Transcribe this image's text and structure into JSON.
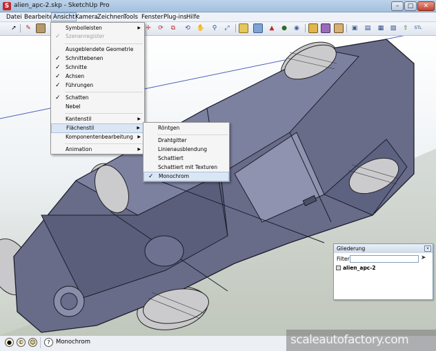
{
  "window": {
    "title": "alien_apc-2.skp - SketchUp Pro"
  },
  "menubar": {
    "items": [
      "Datei",
      "Bearbeiten",
      "Ansicht",
      "Kamera",
      "Zeichnen",
      "Tools",
      "Fenster",
      "Plug-ins",
      "Hilfe"
    ]
  },
  "view_menu": {
    "items": [
      {
        "label": "Symbolleisten",
        "submenu": true
      },
      {
        "label": "Szenenregister",
        "disabled": true,
        "checked": true
      },
      {
        "label": "Ausgeblendete Geometrie"
      },
      {
        "label": "Schnittebenen",
        "checked": true
      },
      {
        "label": "Schnitte",
        "checked": true
      },
      {
        "label": "Achsen",
        "checked": true
      },
      {
        "label": "Führungen",
        "checked": true
      },
      {
        "label": "Schatten",
        "checked": true
      },
      {
        "label": "Nebel"
      },
      {
        "label": "Kantenstil",
        "submenu": true
      },
      {
        "label": "Flächenstil",
        "submenu": true,
        "highlighted": true
      },
      {
        "label": "Komponentenbearbeitung",
        "submenu": true
      },
      {
        "label": "Animation",
        "submenu": true
      }
    ]
  },
  "face_style_menu": {
    "items": [
      {
        "label": "Röntgen"
      },
      {
        "label": "Drahtgitter"
      },
      {
        "label": "Linienausblendung"
      },
      {
        "label": "Schattiert"
      },
      {
        "label": "Schattiert mit Texturen"
      },
      {
        "label": "Monochrom",
        "checked": true,
        "highlighted": true
      }
    ]
  },
  "outline_panel": {
    "title": "Gliederung",
    "filter_label": "Filter:",
    "filter_value": "",
    "tree_item": "alien_apc-2"
  },
  "statusbar": {
    "text": "Monochrom"
  },
  "watermark": {
    "text": "scaleautofactory.com"
  },
  "colors": {
    "model_face": "#6a6e8c",
    "model_edge": "#1b1d2a",
    "menu_highlight": "#dbe6f4"
  }
}
